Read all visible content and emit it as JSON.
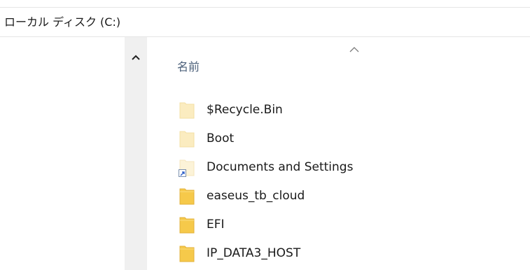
{
  "drive": {
    "title": "ローカル ディスク (C:)"
  },
  "columns": {
    "name_label": "名前",
    "sort": "ascending"
  },
  "files": [
    {
      "name": "$Recycle.Bin",
      "icon": "folder-pale-icon"
    },
    {
      "name": "Boot",
      "icon": "folder-pale-icon"
    },
    {
      "name": "Documents and Settings",
      "icon": "folder-shortcut-icon"
    },
    {
      "name": "easeus_tb_cloud",
      "icon": "folder-icon"
    },
    {
      "name": "EFI",
      "icon": "folder-icon"
    },
    {
      "name": "IP_DATA3_HOST",
      "icon": "folder-icon"
    }
  ],
  "colors": {
    "folder": "#f6c94a",
    "folder_pale": "#fbecc0",
    "header_text": "#4c607a",
    "scroll_track": "#f0f0f0"
  }
}
